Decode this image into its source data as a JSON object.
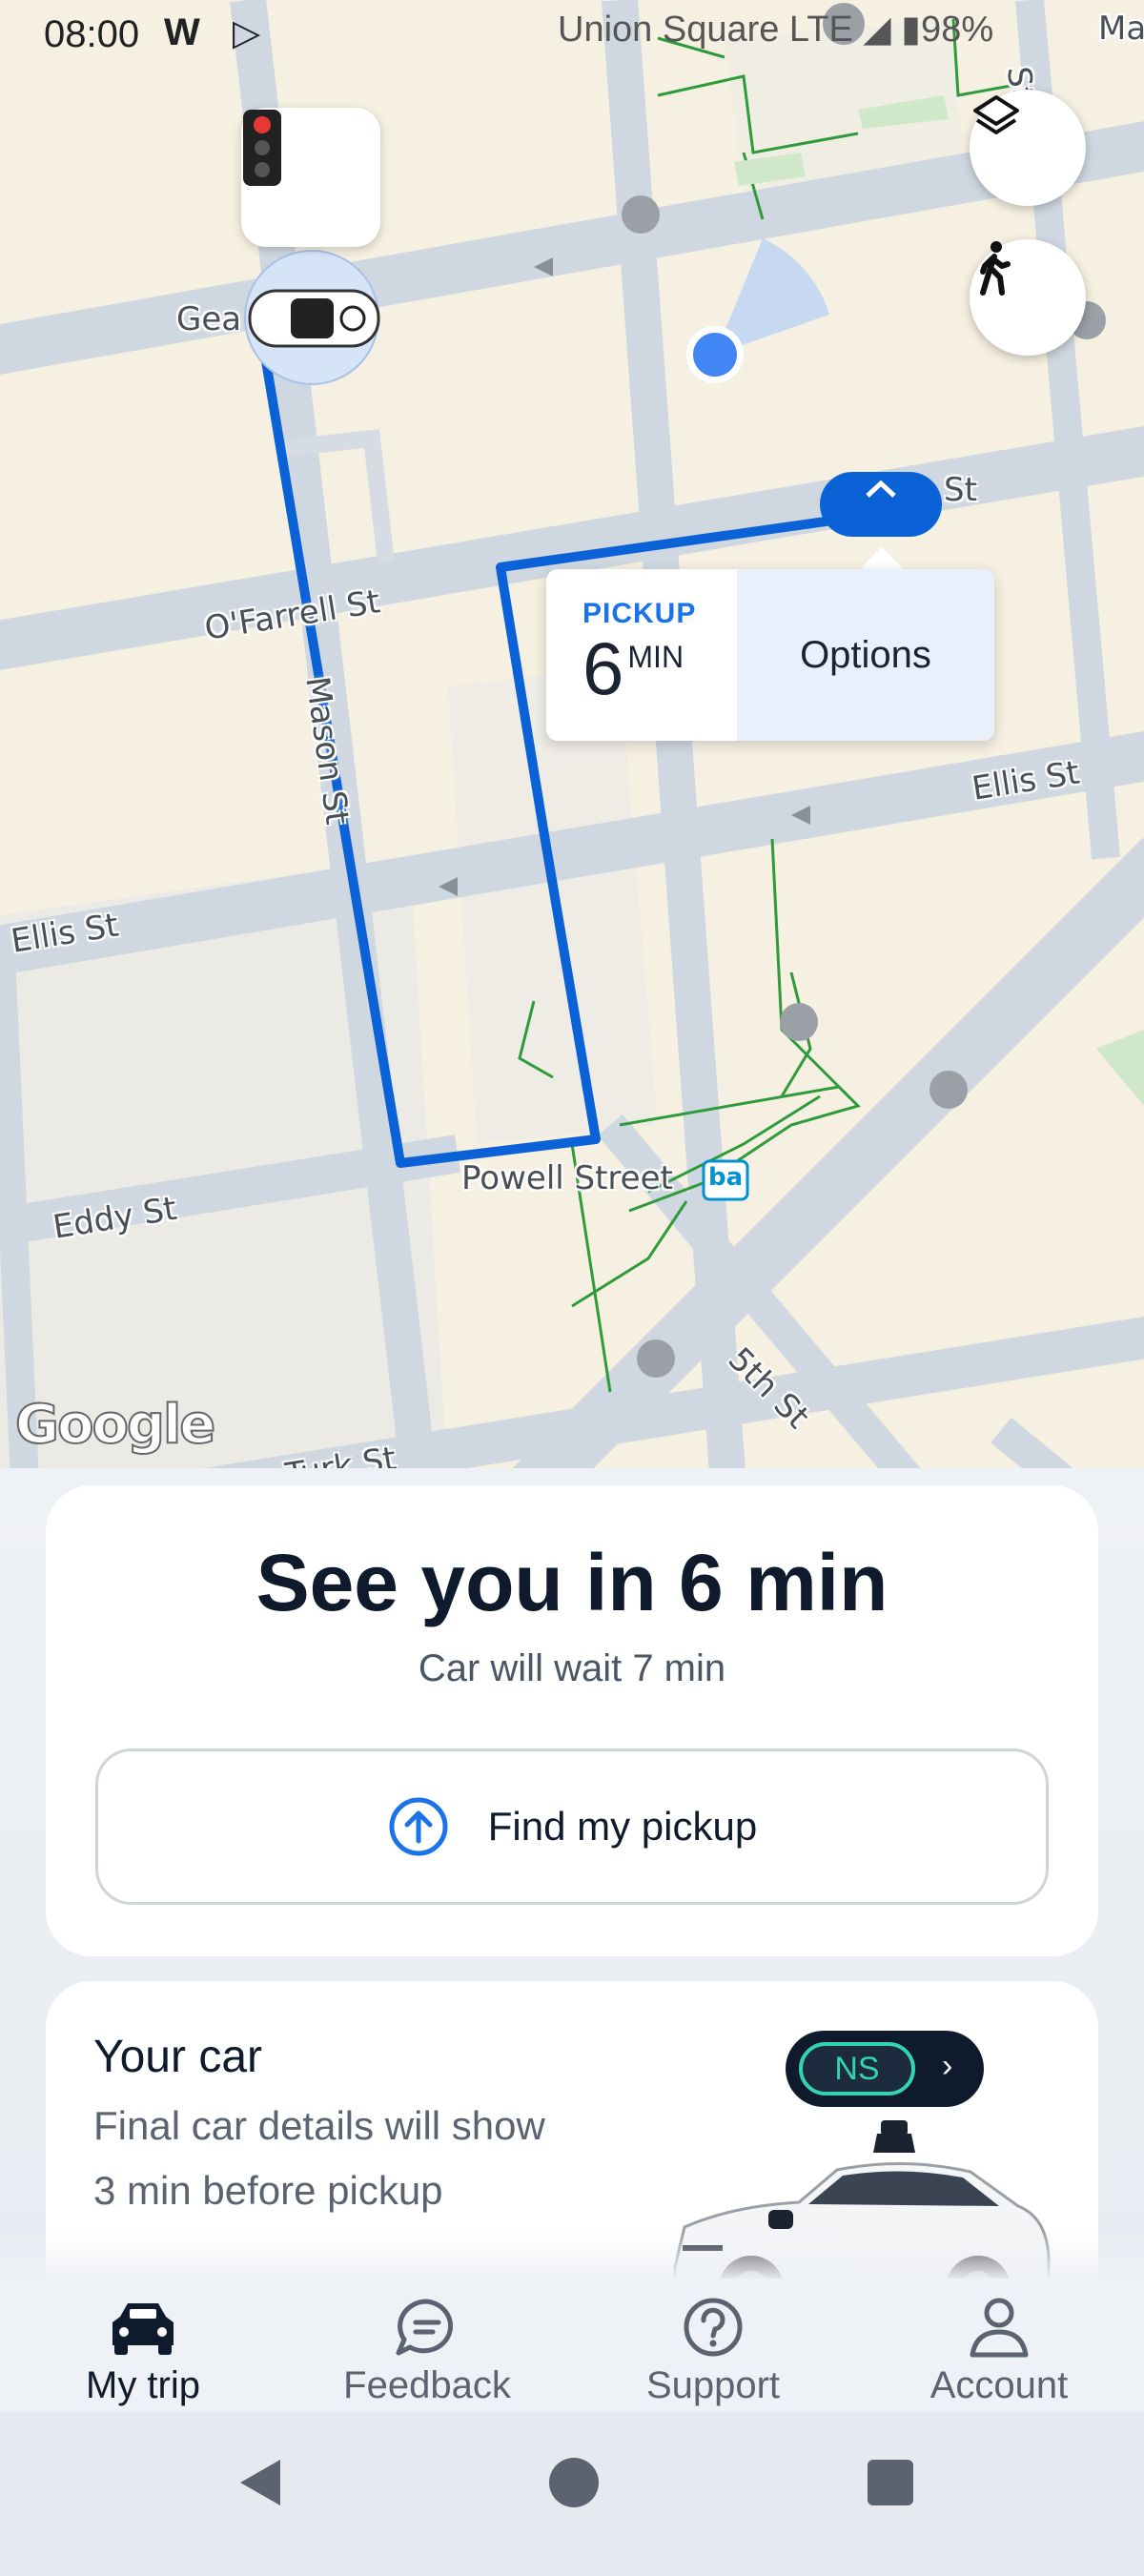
{
  "status_bar": {
    "time": "08:00",
    "app_letter": "W",
    "play_icon": "play-store-icon",
    "right_text": "Union Square LTE ◢ ▮98%"
  },
  "map": {
    "streets": {
      "geary": "Gea",
      "ofarrell": "O'Farrell St",
      "ellis_left": "Ellis St",
      "ellis_right": "Ellis St",
      "eddy": "Eddy St",
      "mason": "Mason St",
      "turk": "Turk St",
      "fifth": "5th St",
      "st_right": "St",
      "powell": "Powell Street",
      "ma": "Ma",
      "top_st": "St"
    },
    "bart_badge": "ba",
    "google": "Google",
    "layers_icon": "layers-icon",
    "walk_icon": "walking-icon",
    "traffic_icon": "traffic-light-icon"
  },
  "pickup_card": {
    "title": "PICKUP",
    "minutes": "6",
    "unit": "MIN",
    "options": "Options"
  },
  "trip_card": {
    "headline": "See you in 6 min",
    "subline": "Car will wait 7 min",
    "find_button": "Find my pickup"
  },
  "car_card": {
    "title": "Your car",
    "description": "Final car details will show 3 min before pickup",
    "badge": "NS"
  },
  "bottom_nav": {
    "items": [
      {
        "label": "My trip",
        "icon": "car-icon",
        "active": true
      },
      {
        "label": "Feedback",
        "icon": "chat-bubble-icon",
        "active": false
      },
      {
        "label": "Support",
        "icon": "help-circle-icon",
        "active": false
      },
      {
        "label": "Account",
        "icon": "person-icon",
        "active": false
      }
    ]
  },
  "colors": {
    "route": "#0b62d6",
    "accent": "#1a73e8",
    "teal": "#34d3b0",
    "dark": "#0f1a2c"
  }
}
